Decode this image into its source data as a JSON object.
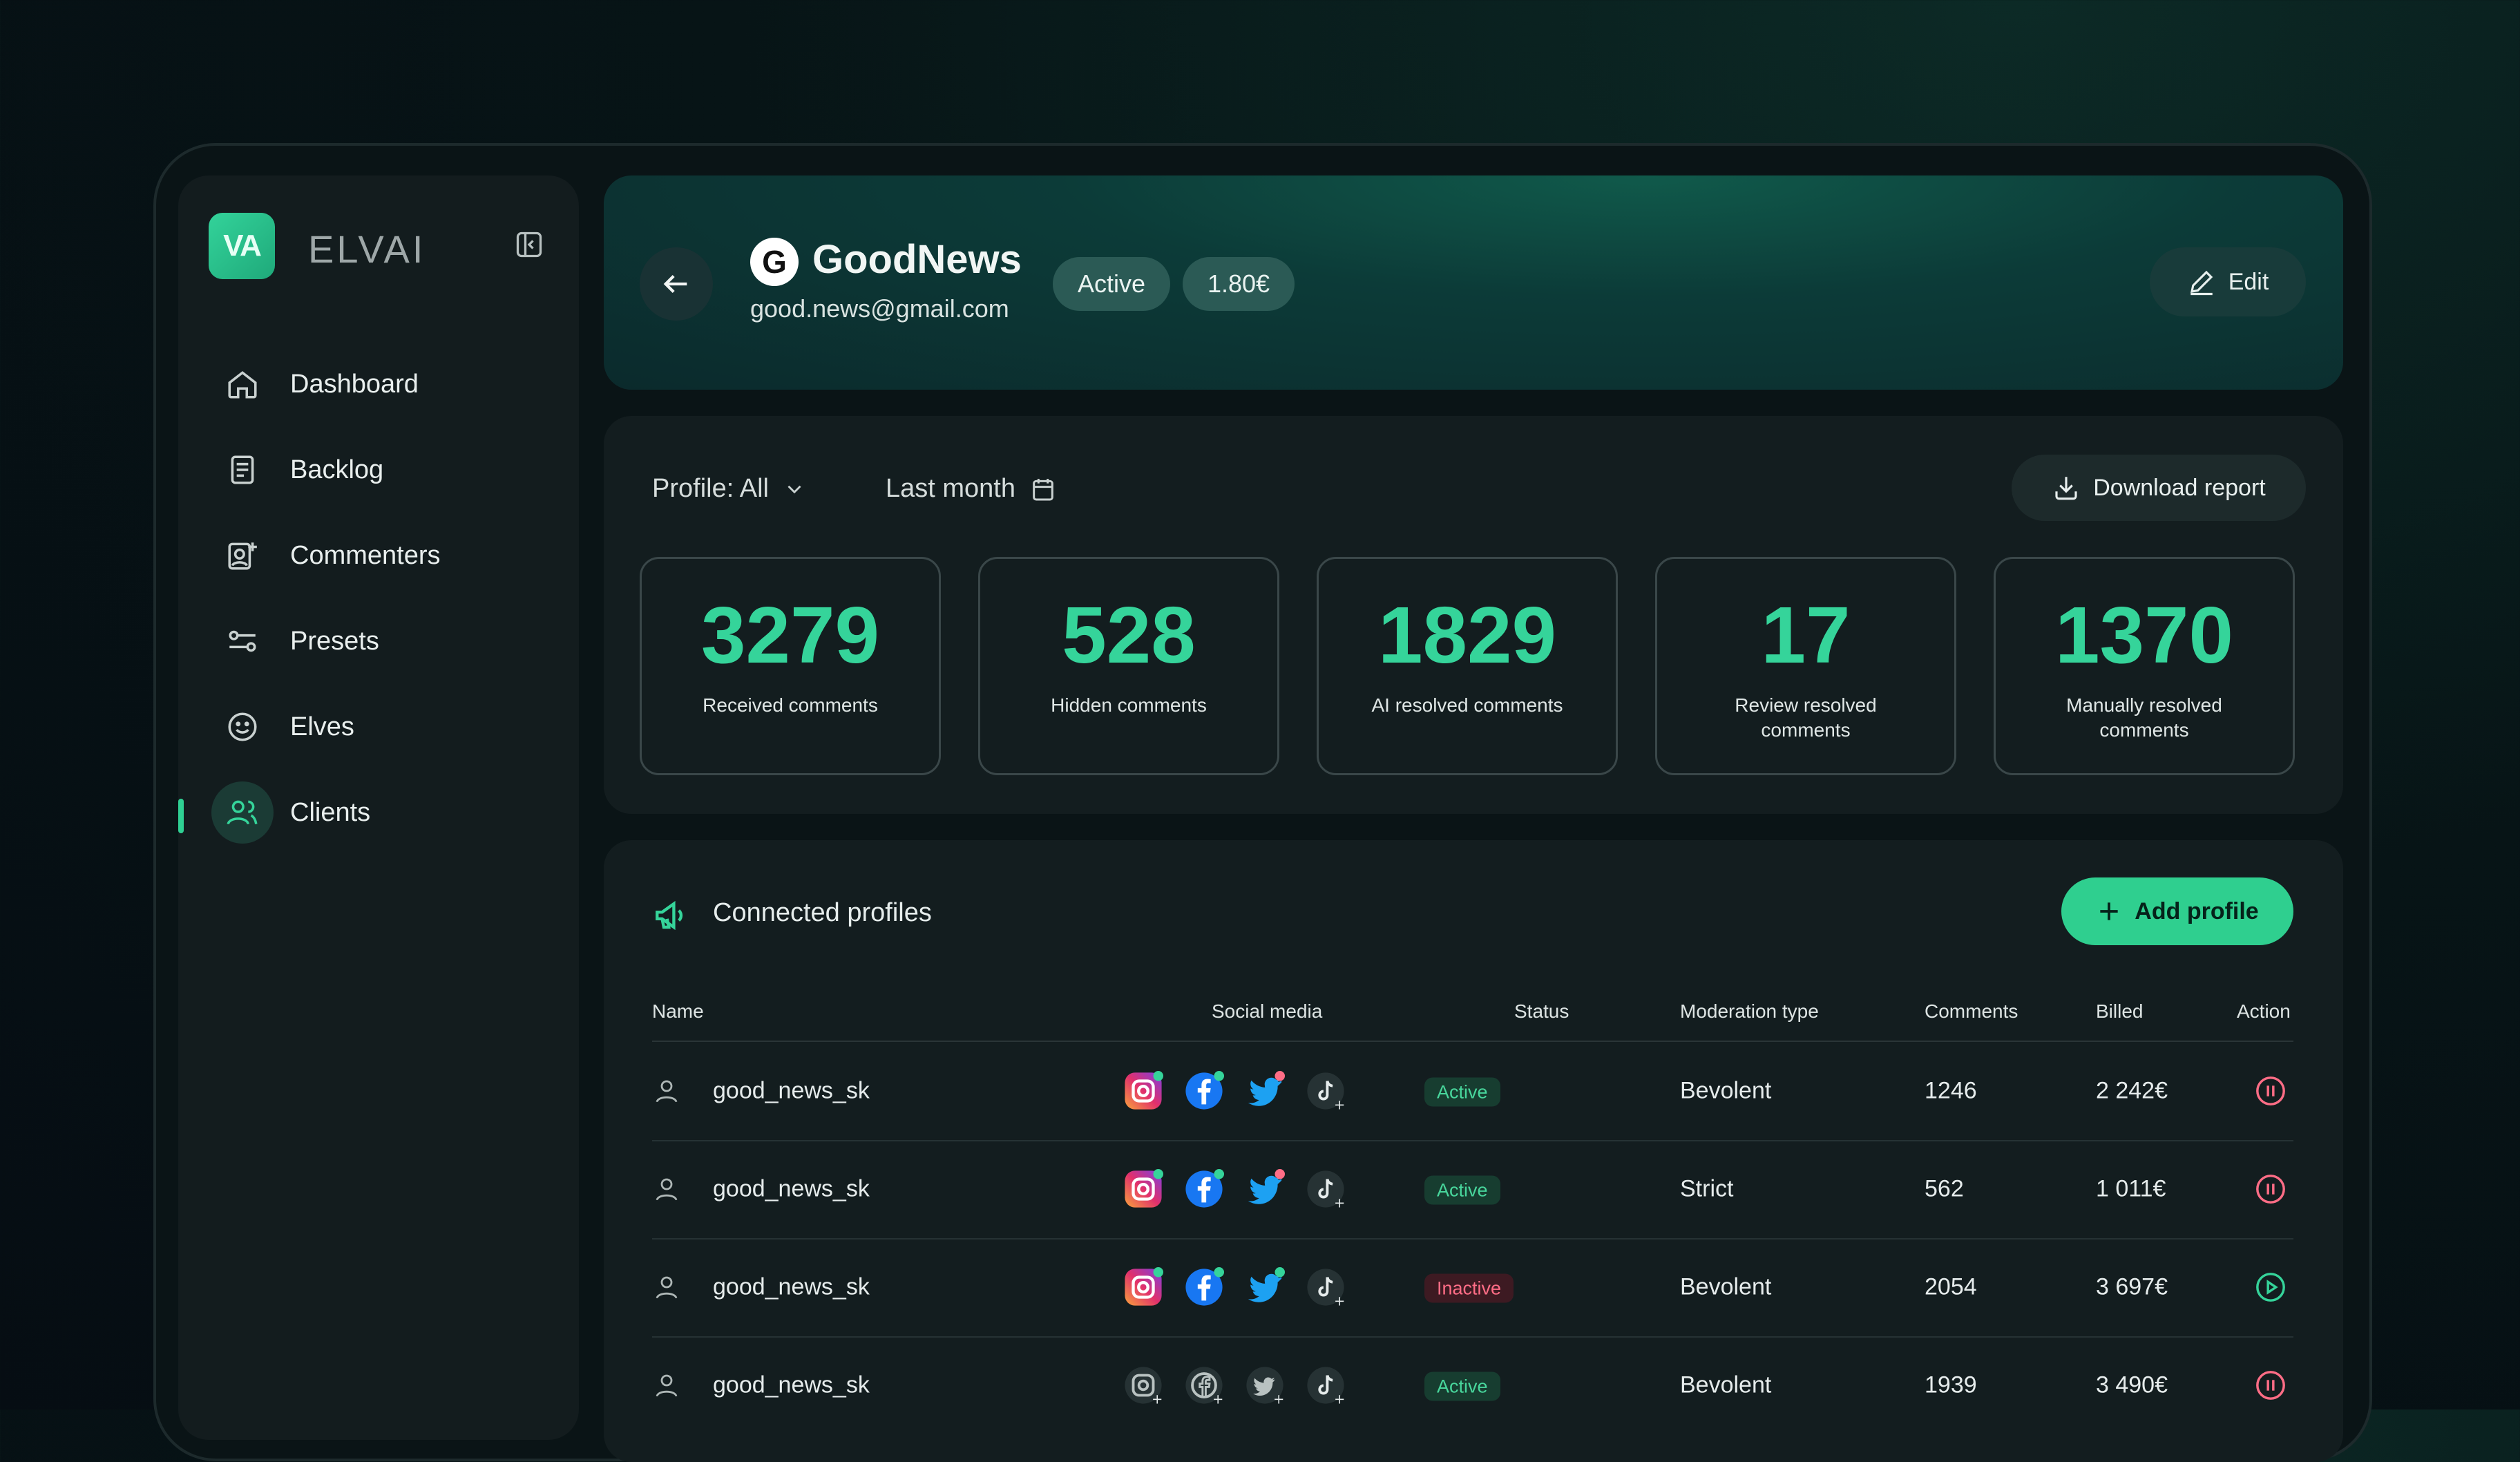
{
  "colors": {
    "accent": "#2fcf8f",
    "active_text": "#48d69c",
    "inactive_text": "#ff6d86",
    "stat_number": "#35d49a"
  },
  "sidebar": {
    "logo_mark": "VA",
    "brand": "ELVAI",
    "items": [
      {
        "label": "Dashboard",
        "icon": "home-icon"
      },
      {
        "label": "Backlog",
        "icon": "document-icon"
      },
      {
        "label": "Commenters",
        "icon": "user-add-icon"
      },
      {
        "label": "Presets",
        "icon": "sliders-icon"
      },
      {
        "label": "Elves",
        "icon": "smiley-icon"
      },
      {
        "label": "Clients",
        "icon": "users-icon",
        "active": true
      }
    ]
  },
  "header": {
    "logo_letter": "G",
    "name": "GoodNews",
    "email": "good.news@gmail.com",
    "status": "Active",
    "price": "1.80€",
    "edit_label": "Edit"
  },
  "filters": {
    "profile": "Profile: All",
    "period": "Last month",
    "download_label": "Download report"
  },
  "stats": [
    {
      "value": "3279",
      "label": "Received comments"
    },
    {
      "value": "528",
      "label": "Hidden comments"
    },
    {
      "value": "1829",
      "label": "AI resolved comments"
    },
    {
      "value": "17",
      "label": "Review resolved comments"
    },
    {
      "value": "1370",
      "label": "Manually resolved comments"
    }
  ],
  "profiles": {
    "title": "Connected profiles",
    "add_label": "Add profile",
    "columns": [
      "Name",
      "Social media",
      "Status",
      "Moderation type",
      "Comments",
      "Billed",
      "Action"
    ],
    "rows": [
      {
        "name": "good_news_sk",
        "status": "Active",
        "moderation": "Bevolent",
        "comments": "1246",
        "billed": "2 242€",
        "action": "pause"
      },
      {
        "name": "good_news_sk",
        "status": "Active",
        "moderation": "Strict",
        "comments": "562",
        "billed": "1 011€",
        "action": "pause"
      },
      {
        "name": "good_news_sk",
        "status": "Inactive",
        "moderation": "Bevolent",
        "comments": "2054",
        "billed": "3 697€",
        "action": "play"
      },
      {
        "name": "good_news_sk",
        "status": "Active",
        "moderation": "Bevolent",
        "comments": "1939",
        "billed": "3 490€",
        "action": "pause"
      }
    ]
  }
}
